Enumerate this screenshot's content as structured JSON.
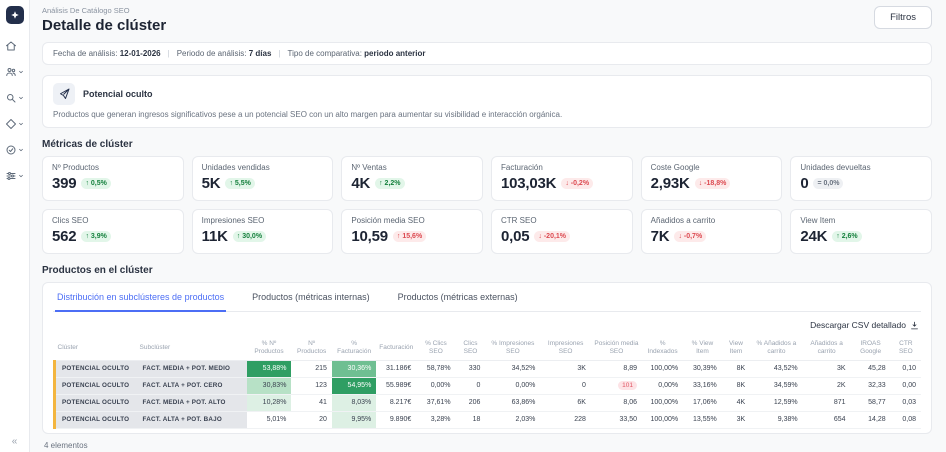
{
  "colors": {
    "accent": "#4c6ef5",
    "positive": "#15803d",
    "negative": "#dc4a51",
    "heat_dark_green": "#2f9e63",
    "row_accent": "#f3b53f"
  },
  "sidebar": {
    "collapse": "«",
    "items": [
      {
        "icon": "home-icon",
        "has_chevron": false
      },
      {
        "icon": "users-icon",
        "has_chevron": true
      },
      {
        "icon": "search-icon",
        "has_chevron": true
      },
      {
        "icon": "tag-icon",
        "has_chevron": true
      },
      {
        "icon": "status-circle-icon",
        "has_chevron": true
      },
      {
        "icon": "sliders-icon",
        "has_chevron": true
      }
    ]
  },
  "header": {
    "breadcrumb": "Análisis De Catálogo SEO",
    "title": "Detalle de clúster",
    "filters_button": "Filtros"
  },
  "filter_bar": [
    {
      "label": "Fecha de análisis:",
      "value": "12-01-2026"
    },
    {
      "label": "Periodo de análisis:",
      "value": "7 días"
    },
    {
      "label": "Tipo de comparativa:",
      "value": "periodo anterior"
    }
  ],
  "banner": {
    "title": "Potencial oculto",
    "description": "Productos que generan ingresos significativos pese a un potencial SEO con un alto margen para aumentar su visibilidad e interacción orgánica."
  },
  "metrics": {
    "title": "Métricas de clúster",
    "cards": [
      {
        "label": "Nº Productos",
        "value": "399",
        "arrow": "↑",
        "delta": "0,5%",
        "tone": "positive"
      },
      {
        "label": "Unidades vendidas",
        "value": "5K",
        "arrow": "↑",
        "delta": "5,5%",
        "tone": "positive"
      },
      {
        "label": "Nº Ventas",
        "value": "4K",
        "arrow": "↑",
        "delta": "2,2%",
        "tone": "positive"
      },
      {
        "label": "Facturación",
        "value": "103,03K",
        "arrow": "↓",
        "delta": "-0,2%",
        "tone": "negative"
      },
      {
        "label": "Coste Google",
        "value": "2,93K",
        "arrow": "↓",
        "delta": "-18,8%",
        "tone": "negative"
      },
      {
        "label": "Unidades devueltas",
        "value": "0",
        "arrow": "=",
        "delta": "0,0%",
        "tone": "neutral"
      },
      {
        "label": "Clics SEO",
        "value": "562",
        "arrow": "↑",
        "delta": "3,9%",
        "tone": "positive"
      },
      {
        "label": "Impresiones SEO",
        "value": "11K",
        "arrow": "↑",
        "delta": "30,0%",
        "tone": "positive"
      },
      {
        "label": "Posición media SEO",
        "value": "10,59",
        "arrow": "↑",
        "delta": "15,6%",
        "tone": "negative"
      },
      {
        "label": "CTR SEO",
        "value": "0,05",
        "arrow": "↓",
        "delta": "-20,1%",
        "tone": "negative"
      },
      {
        "label": "Añadidos a carrito",
        "value": "7K",
        "arrow": "↓",
        "delta": "-0,7%",
        "tone": "negative"
      },
      {
        "label": "View Item",
        "value": "24K",
        "arrow": "↑",
        "delta": "2,6%",
        "tone": "positive"
      }
    ]
  },
  "products": {
    "title": "Productos en el clúster",
    "tabs": [
      {
        "label": "Distribución en subclústeres de productos",
        "active": true
      },
      {
        "label": "Productos (métricas internas)",
        "active": false
      },
      {
        "label": "Productos (métricas externas)",
        "active": false
      }
    ],
    "download_label": "Descargar CSV detallado",
    "footer": "4 elementos",
    "table": {
      "columns": [
        "Clúster",
        "Subclúster",
        "% Nº Productos",
        "Nº Productos",
        "% Facturación",
        "Facturación",
        "% Clics SEO",
        "Clics SEO",
        "% Impresiones SEO",
        "Impresiones SEO",
        "Posición media SEO",
        "% Indexados",
        "% View Item",
        "View Item",
        "% Añadidos a carrito",
        "Añadidos a carrito",
        "IROAS Google",
        "CTR SEO"
      ],
      "rows": [
        {
          "cluster": "POTENCIAL OCULTO",
          "subcluster": "FACT. MEDIA + POT. MEDIO",
          "cells": [
            "53,88%",
            "215",
            "30,36%",
            "31.186€",
            "58,78%",
            "330",
            "34,52%",
            "3K",
            "8,89",
            "100,00%",
            "30,39%",
            "8K",
            "43,52%",
            "3K",
            "45,28",
            "0,10"
          ],
          "heat": {
            "0": 4,
            "2": 3
          },
          "alerts": {}
        },
        {
          "cluster": "POTENCIAL OCULTO",
          "subcluster": "FACT. ALTA + POT. CERO",
          "cells": [
            "30,83%",
            "123",
            "54,95%",
            "55.989€",
            "0,00%",
            "0",
            "0,00%",
            "0",
            "101",
            "0,00%",
            "33,16%",
            "8K",
            "34,59%",
            "2K",
            "32,33",
            "0,00"
          ],
          "heat": {
            "0": 2,
            "2": 4
          },
          "alerts": {
            "8": true
          }
        },
        {
          "cluster": "POTENCIAL OCULTO",
          "subcluster": "FACT. MEDIA + POT. ALTO",
          "cells": [
            "10,28%",
            "41",
            "8,03%",
            "8.217€",
            "37,61%",
            "206",
            "63,86%",
            "6K",
            "8,06",
            "100,00%",
            "17,06%",
            "4K",
            "12,59%",
            "871",
            "58,77",
            "0,03"
          ],
          "heat": {
            "0": 1,
            "2": 1
          },
          "alerts": {}
        },
        {
          "cluster": "POTENCIAL OCULTO",
          "subcluster": "FACT. ALTA + POT. BAJO",
          "cells": [
            "5,01%",
            "20",
            "9,95%",
            "9.890€",
            "3,28%",
            "18",
            "2,03%",
            "228",
            "33,50",
            "100,00%",
            "13,55%",
            "3K",
            "9,38%",
            "654",
            "14,28",
            "0,08"
          ],
          "heat": {
            "2": 1
          },
          "alerts": {}
        }
      ]
    }
  }
}
